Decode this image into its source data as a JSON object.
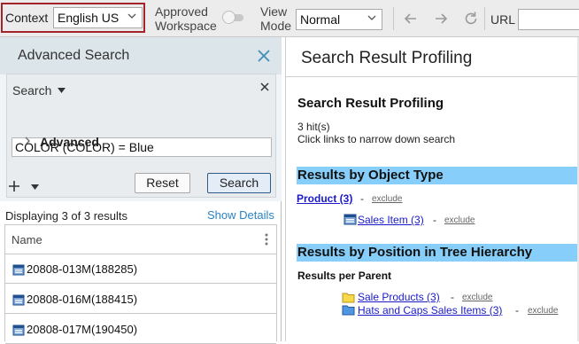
{
  "toolbar": {
    "context_label": "Context",
    "context_value": "English US",
    "approved_line1": "Approved",
    "approved_line2": "Workspace",
    "view_line1": "View",
    "view_line2": "Mode",
    "view_value": "Normal",
    "url_label": "URL",
    "url_value": "",
    "accent_color": "#a5232a"
  },
  "left": {
    "title": "Advanced Search",
    "criteria_label": "Search",
    "criteria_value": "COLOR (COLOR) = Blue",
    "advanced_label": "Advanced",
    "reset_label": "Reset",
    "search_label": "Search",
    "displaying": "Displaying 3 of 3 results",
    "show_details": "Show Details",
    "grid": {
      "column": "Name",
      "rows": [
        {
          "name": "20808-013M(188285)"
        },
        {
          "name": "20808-016M(188415)"
        },
        {
          "name": "20808-017M(190450)"
        }
      ]
    }
  },
  "right": {
    "header_title": "Search Result Profiling",
    "profiling_title": "Search Result Profiling",
    "hits": "3 hit(s)",
    "hint": "Click links to narrow down search",
    "section1": "Results by Object Type",
    "product_link": "Product (3)",
    "sales_item_link": "Sales Item (3)",
    "section2": "Results by Position in Tree Hierarchy",
    "results_per_parent": "Results per Parent",
    "sale_products_link": "Sale Products (3)",
    "hats_caps_link": "Hats and Caps Sales Items (3)",
    "exclude": "exclude",
    "dash": "-",
    "section_color": "#87cefa",
    "link_color": "#1a1ac8"
  }
}
